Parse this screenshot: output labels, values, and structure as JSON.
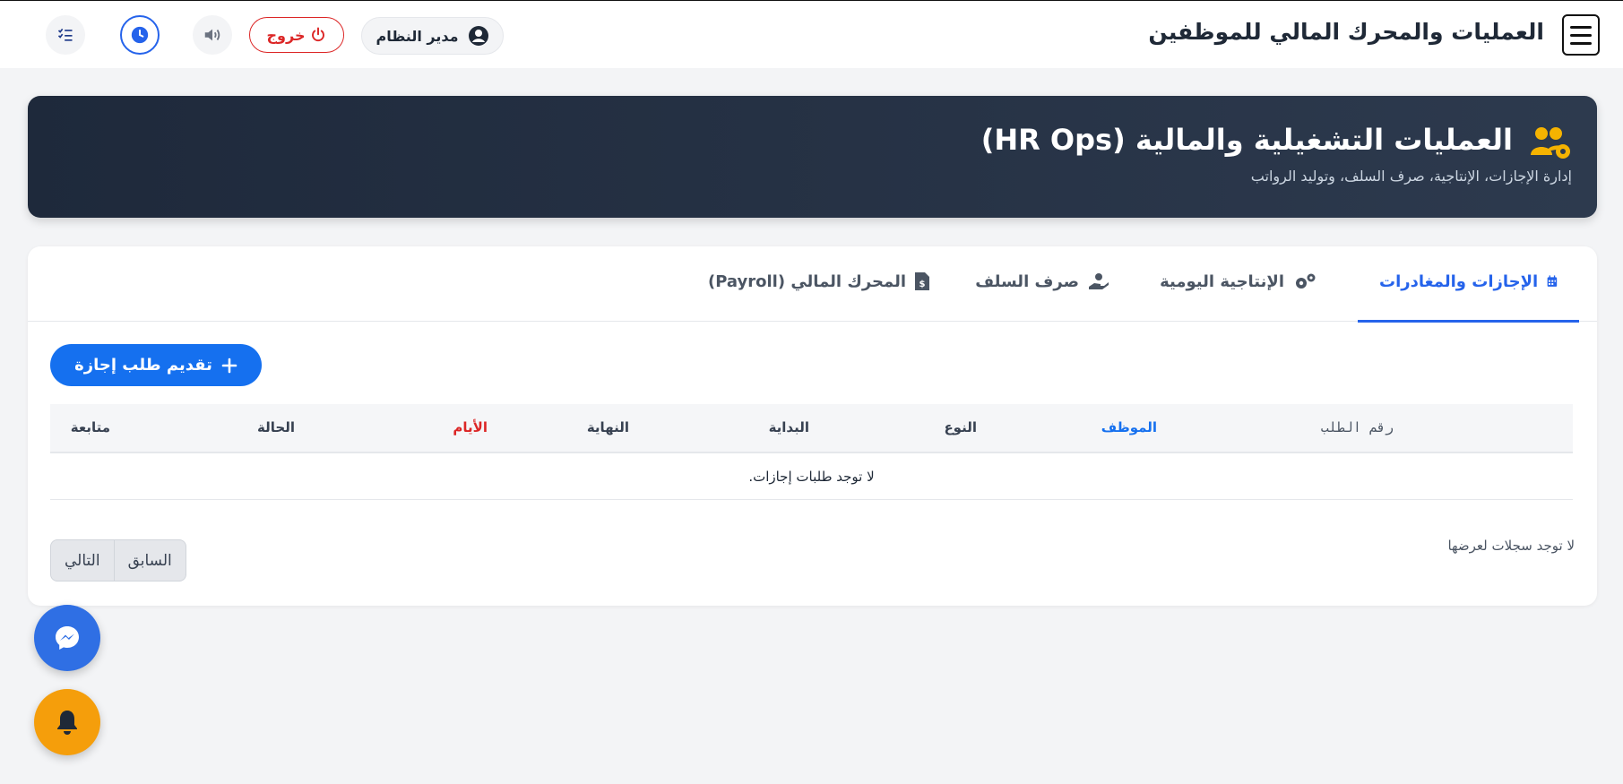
{
  "header": {
    "app_title": "العمليات والمحرك المالي للموظفين",
    "user_label": "مدير النظام",
    "logout_label": "خروج",
    "icons": [
      "menu-icon",
      "user-circle-icon",
      "power-icon",
      "volume-icon",
      "clock-icon",
      "tasks-icon"
    ]
  },
  "hero": {
    "title": "العمليات التشغيلية والمالية (HR Ops)",
    "subtitle": "إدارة الإجازات، الإنتاجية، صرف السلف، وتوليد الرواتب",
    "icon": "users-cog-icon"
  },
  "tabs": [
    {
      "label": "الإجازات والمغادرات",
      "icon": "calendar-icon",
      "active": true
    },
    {
      "label": "الإنتاجية اليومية",
      "icon": "cogs-icon",
      "active": false
    },
    {
      "label": "صرف السلف",
      "icon": "hand-coin-icon",
      "active": false
    },
    {
      "label": "المحرك المالي (Payroll)",
      "icon": "invoice-dollar-icon",
      "active": false
    }
  ],
  "actions": {
    "add_leave_label": "تقديم طلب إجازة"
  },
  "table": {
    "columns": [
      "رقم الطلب",
      "الموظف",
      "النوع",
      "البداية",
      "النهاية",
      "الأيام",
      "الحالة",
      "متابعة"
    ],
    "empty_message": "لا توجد طلبات إجازات."
  },
  "pagination": {
    "info": "لا توجد سجلات لعرضها",
    "prev_label": "السابق",
    "next_label": "التالي"
  },
  "colors": {
    "primary": "#1570ef",
    "danger": "#dc2626",
    "hero_bg": "#1e293b",
    "accent_yellow": "#f5b301",
    "bell_bg": "#f59e0b"
  }
}
